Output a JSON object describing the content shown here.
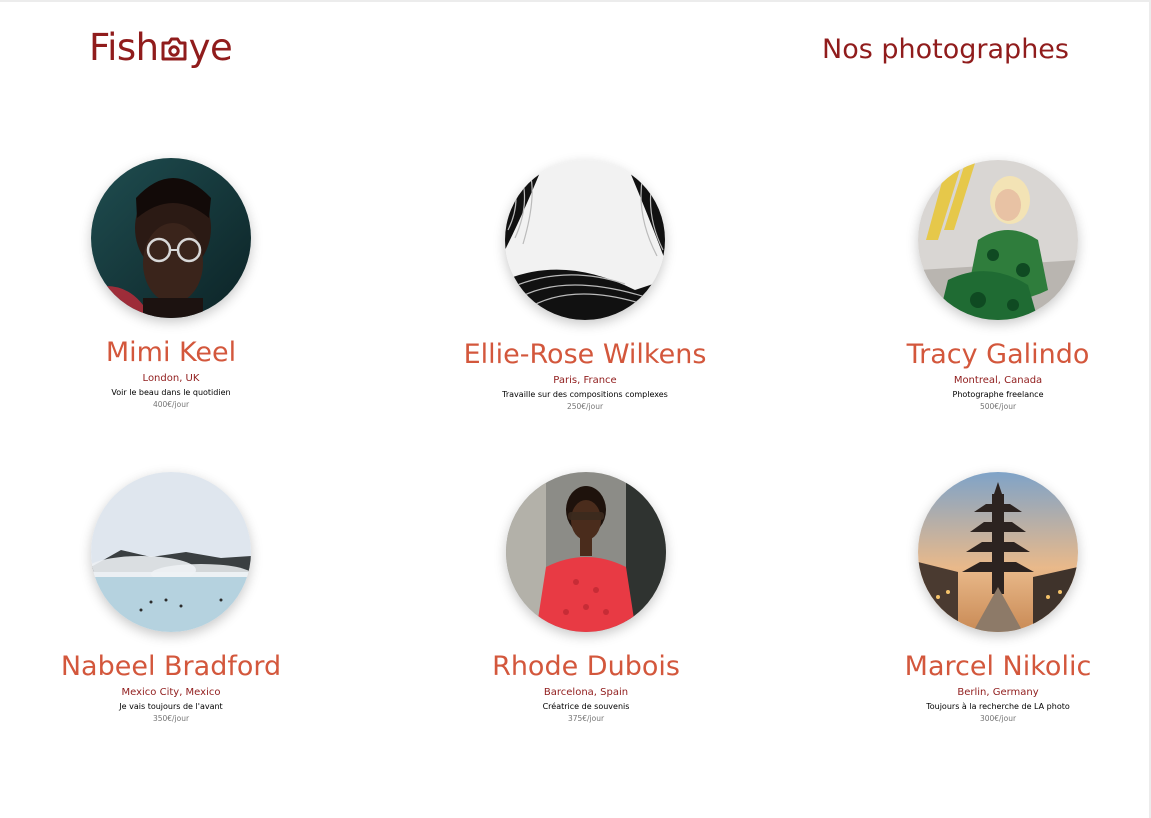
{
  "header": {
    "logo_text_start": "Fish",
    "logo_text_end": "ye",
    "title": "Nos photographes"
  },
  "photographers": [
    {
      "name": "Mimi Keel",
      "location": "London, UK",
      "tagline": "Voir le beau dans le quotidien",
      "price": "400€/jour"
    },
    {
      "name": "Ellie-Rose Wilkens",
      "location": "Paris, France",
      "tagline": "Travaille sur des compositions complexes",
      "price": "250€/jour"
    },
    {
      "name": "Tracy Galindo",
      "location": "Montreal, Canada",
      "tagline": "Photographe freelance",
      "price": "500€/jour"
    },
    {
      "name": "Nabeel Bradford",
      "location": "Mexico City, Mexico",
      "tagline": "Je vais toujours de l'avant",
      "price": "350€/jour"
    },
    {
      "name": "Rhode Dubois",
      "location": "Barcelona, Spain",
      "tagline": "Créatrice de souvenis",
      "price": "375€/jour"
    },
    {
      "name": "Marcel Nikolic",
      "location": "Berlin, Germany",
      "tagline": "Toujours à la recherche de LA photo",
      "price": "300€/jour"
    }
  ],
  "colors": {
    "primary": "#901C1C",
    "name": "#D3573C",
    "price": "#757575"
  },
  "icons": {
    "logo": "camera-icon"
  }
}
